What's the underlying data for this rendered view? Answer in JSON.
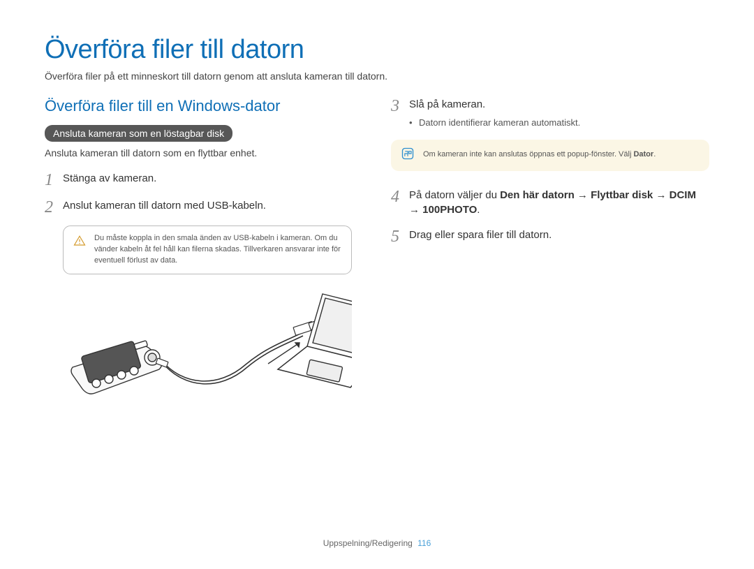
{
  "title": "Överföra filer till datorn",
  "intro": "Överföra filer på ett minneskort till datorn genom att ansluta kameran till datorn.",
  "left": {
    "section_title": "Överföra filer till en Windows-dator",
    "pill": "Ansluta kameran som en löstagbar disk",
    "pill_sub": "Ansluta kameran till datorn som en flyttbar enhet.",
    "step1_num": "1",
    "step1_text": "Stänga av kameran.",
    "step2_num": "2",
    "step2_text": "Anslut kameran till datorn med USB-kabeln.",
    "warn_text": "Du måste koppla in den smala änden av USB-kabeln i kameran. Om du vänder kabeln åt fel håll kan filerna skadas. Tillverkaren ansvarar inte för eventuell förlust av data."
  },
  "right": {
    "step3_num": "3",
    "step3_text": "Slå på kameran.",
    "step3_bullet": "Datorn identifierar kameran automatiskt.",
    "note_prefix": "Om kameran inte kan anslutas öppnas ett popup-fönster. Välj ",
    "note_bold": "Dator",
    "note_suffix": ".",
    "step4_num": "4",
    "step4_prefix": "På datorn väljer du ",
    "step4_path": "Den här datorn → Flyttbar disk → DCIM → 100PHOTO",
    "step4_suffix": ".",
    "step5_num": "5",
    "step5_text": "Drag eller spara filer till datorn."
  },
  "footer": {
    "section": "Uppspelning/Redigering",
    "page": "116"
  }
}
